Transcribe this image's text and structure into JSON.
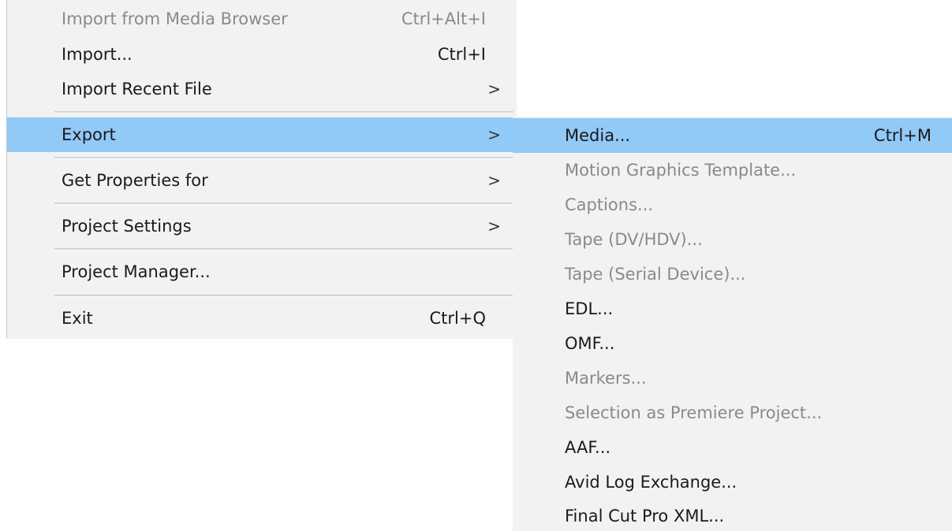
{
  "main_menu": {
    "items": [
      {
        "label": "Import from Media Browser",
        "shortcut": "Ctrl+Alt+I",
        "disabled": true
      },
      {
        "label": "Import...",
        "shortcut": "Ctrl+I"
      },
      {
        "label": "Import Recent File",
        "submenu": true
      },
      {
        "label": "Export",
        "submenu": true,
        "highlighted": true
      },
      {
        "label": "Get Properties for",
        "submenu": true
      },
      {
        "label": "Project Settings",
        "submenu": true
      },
      {
        "label": "Project Manager..."
      },
      {
        "label": "Exit",
        "shortcut": "Ctrl+Q"
      }
    ],
    "arrow_glyph": ">"
  },
  "export_submenu": {
    "items": [
      {
        "label": "Media...",
        "shortcut": "Ctrl+M",
        "highlighted": true
      },
      {
        "label": "Motion Graphics Template...",
        "disabled": true
      },
      {
        "label": "Captions...",
        "disabled": true
      },
      {
        "label": "Tape (DV/HDV)...",
        "disabled": true
      },
      {
        "label": "Tape (Serial Device)...",
        "disabled": true
      },
      {
        "label": "EDL..."
      },
      {
        "label": "OMF..."
      },
      {
        "label": "Markers...",
        "disabled": true
      },
      {
        "label": "Selection as Premiere Project...",
        "disabled": true
      },
      {
        "label": "AAF..."
      },
      {
        "label": "Avid Log Exchange..."
      },
      {
        "label": "Final Cut Pro XML..."
      }
    ]
  },
  "colors": {
    "menu_bg": "#f2f2f2",
    "highlight": "#91c9f7",
    "text": "#1a1a1a",
    "disabled_text": "#8a8a8a",
    "separator": "#d4d4d4"
  }
}
